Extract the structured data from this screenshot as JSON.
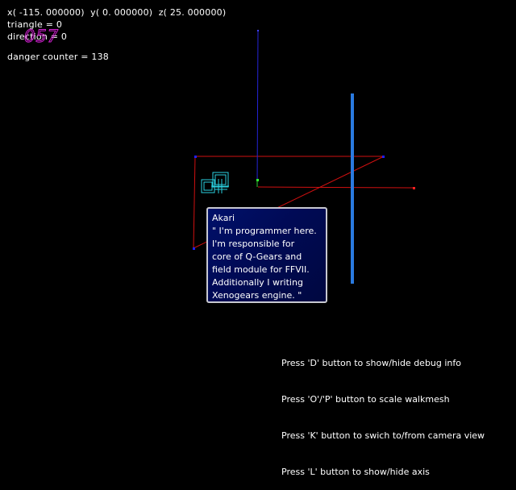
{
  "debug": {
    "position_line": "x( -115. 000000)  y( 0. 000000)  z( 25. 000000)",
    "triangle_line": "triangle = 0",
    "direction_line": "direction = 0",
    "fps_overlay": "057",
    "danger_line": "danger counter = 138"
  },
  "dialog": {
    "speaker": "Akari",
    "lines": [
      "\" I'm programmer here.",
      "I'm responsible for",
      "core of Q-Gears and",
      "field module for FFVII.",
      "Additionally I writing",
      "Xenogears engine. \""
    ]
  },
  "help": {
    "lines": [
      "Press 'D' button to show/hide debug info",
      "Press 'O'/'P' button to scale walkmesh",
      "Press 'K' button to swich to/from camera view",
      "Press 'L' button to show/hide axis"
    ]
  },
  "colors": {
    "background": "#000000",
    "walkmesh_edge": "#d01010",
    "axis_vertical": "#1a1aff",
    "gateway_bar": "#2a7ae0",
    "model_outline": "#2ad0e0",
    "fps_overlay": "#d020d0",
    "dialog_bg": "#000a55",
    "dialog_border": "#c8c8d0"
  },
  "icons": {
    "character_model": "wireframe-character-icon",
    "axis_origin": "axis-origin-marker"
  }
}
